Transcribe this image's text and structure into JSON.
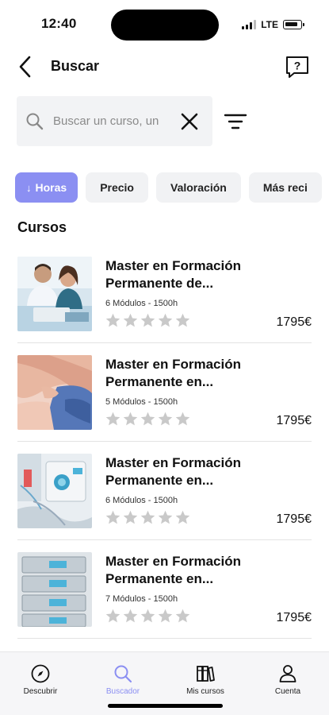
{
  "status": {
    "time": "12:40",
    "network": "LTE"
  },
  "header": {
    "title": "Buscar"
  },
  "search": {
    "placeholder": "Buscar un curso, un"
  },
  "filters": [
    {
      "label": "Horas",
      "active": true,
      "arrow": "↓"
    },
    {
      "label": "Precio",
      "active": false
    },
    {
      "label": "Valoración",
      "active": false
    },
    {
      "label": "Más reci",
      "active": false
    }
  ],
  "section": {
    "title": "Cursos"
  },
  "courses": [
    {
      "title": "Master en Formación Permanente de...",
      "meta": "6 Módulos - 1500h",
      "price": "1795€",
      "rating": 0,
      "image": "people-smiling"
    },
    {
      "title": "Master en Formación Permanente en...",
      "meta": "5 Módulos - 1500h",
      "price": "1795€",
      "rating": 0,
      "image": "knee-exam"
    },
    {
      "title": "Master en Formación Permanente en...",
      "meta": "6 Módulos - 1500h",
      "price": "1795€",
      "rating": 0,
      "image": "medical-equipment"
    },
    {
      "title": "Master en Formación Permanente en...",
      "meta": "7 Módulos - 1500h",
      "price": "1795€",
      "rating": 0,
      "image": "infusion-pumps"
    }
  ],
  "nav": [
    {
      "label": "Descubrir",
      "icon": "compass-icon",
      "active": false
    },
    {
      "label": "Buscador",
      "icon": "search-icon",
      "active": true
    },
    {
      "label": "Mis cursos",
      "icon": "books-icon",
      "active": false
    },
    {
      "label": "Cuenta",
      "icon": "user-icon",
      "active": false
    }
  ],
  "colors": {
    "accent": "#8b8ff2",
    "star": "#c9c9c9",
    "search_bg": "#f2f3f5"
  }
}
